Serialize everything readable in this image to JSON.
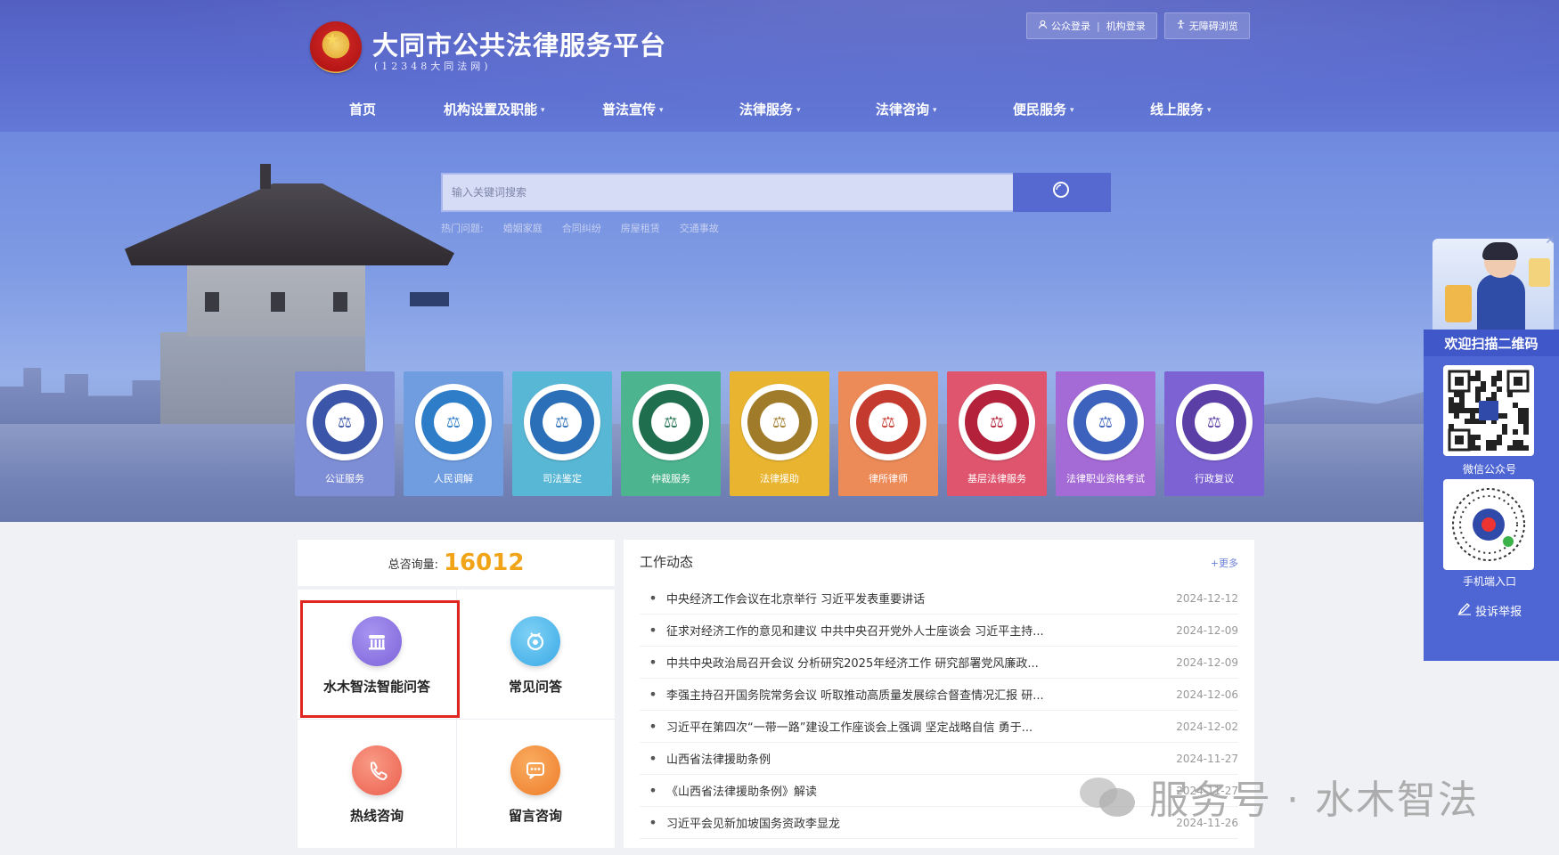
{
  "header": {
    "title": "大同市公共法律服务平台",
    "subtitle": "(12348大同法网)",
    "top_links": {
      "public_login": "公众登录",
      "org_login": "机构登录",
      "accessibility": "无障碍浏览"
    }
  },
  "nav": [
    {
      "label": "首页",
      "dropdown": false
    },
    {
      "label": "机构设置及职能",
      "dropdown": true
    },
    {
      "label": "普法宣传",
      "dropdown": true
    },
    {
      "label": "法律服务",
      "dropdown": true
    },
    {
      "label": "法律咨询",
      "dropdown": true
    },
    {
      "label": "便民服务",
      "dropdown": true
    },
    {
      "label": "线上服务",
      "dropdown": true
    }
  ],
  "search": {
    "placeholder": "输入关键词搜索",
    "hot_label": "热门问题:",
    "hot_terms": [
      "婚姻家庭",
      "合同纠纷",
      "房屋租赁",
      "交通事故"
    ]
  },
  "tiles": [
    {
      "label": "公证服务",
      "color": "#7e8ed6",
      "badge": "#3b55a8"
    },
    {
      "label": "人民调解",
      "color": "#6f9de0",
      "badge": "#2d7dc9"
    },
    {
      "label": "司法鉴定",
      "color": "#59b7d6",
      "badge": "#2b6fb8"
    },
    {
      "label": "仲裁服务",
      "color": "#4cb48f",
      "badge": "#1f6f4e"
    },
    {
      "label": "法律援助",
      "color": "#e9b530",
      "badge": "#a07c2a"
    },
    {
      "label": "律所律师",
      "color": "#ec8a58",
      "badge": "#c53a2f"
    },
    {
      "label": "基层法律服务",
      "color": "#e0556e",
      "badge": "#b3213a"
    },
    {
      "label": "法律职业资格考试",
      "color": "#a46ad6",
      "badge": "#3d62bd"
    },
    {
      "label": "行政复议",
      "color": "#7c62d2",
      "badge": "#5b3fa6"
    }
  ],
  "consult": {
    "count_label": "总咨询量:",
    "count_value": "16012",
    "items": [
      {
        "label": "水木智法智能问答",
        "color": "#8a72e0"
      },
      {
        "label": "常见问答",
        "color": "#47b7ea"
      },
      {
        "label": "热线咨询",
        "color": "#f0735d"
      },
      {
        "label": "留言咨询",
        "color": "#f28f3b"
      }
    ]
  },
  "news": {
    "title": "工作动态",
    "more": "+更多",
    "items": [
      {
        "text": "中央经济工作会议在北京举行 习近平发表重要讲话",
        "date": "2024-12-12"
      },
      {
        "text": "征求对经济工作的意见和建议 中共中央召开党外人士座谈会 习近平主持...",
        "date": "2024-12-09"
      },
      {
        "text": "中共中央政治局召开会议 分析研究2025年经济工作 研究部署党风廉政...",
        "date": "2024-12-09"
      },
      {
        "text": "李强主持召开国务院常务会议 听取推动高质量发展综合督查情况汇报 研...",
        "date": "2024-12-06"
      },
      {
        "text": "习近平在第四次“一带一路”建设工作座谈会上强调 坚定战略自信 勇于...",
        "date": "2024-12-02"
      },
      {
        "text": "山西省法律援助条例",
        "date": "2024-11-27"
      },
      {
        "text": "《山西省法律援助条例》解读",
        "date": "2024-11-27"
      },
      {
        "text": "习近平会见新加坡国务资政李显龙",
        "date": "2024-11-26"
      }
    ]
  },
  "float_panel": {
    "heading": "欢迎扫描二维码",
    "wechat_label": "微信公众号",
    "mobile_label": "手机端入口",
    "report_label": "投诉举报"
  },
  "watermark": {
    "text": "服务号 · 水木智法"
  }
}
